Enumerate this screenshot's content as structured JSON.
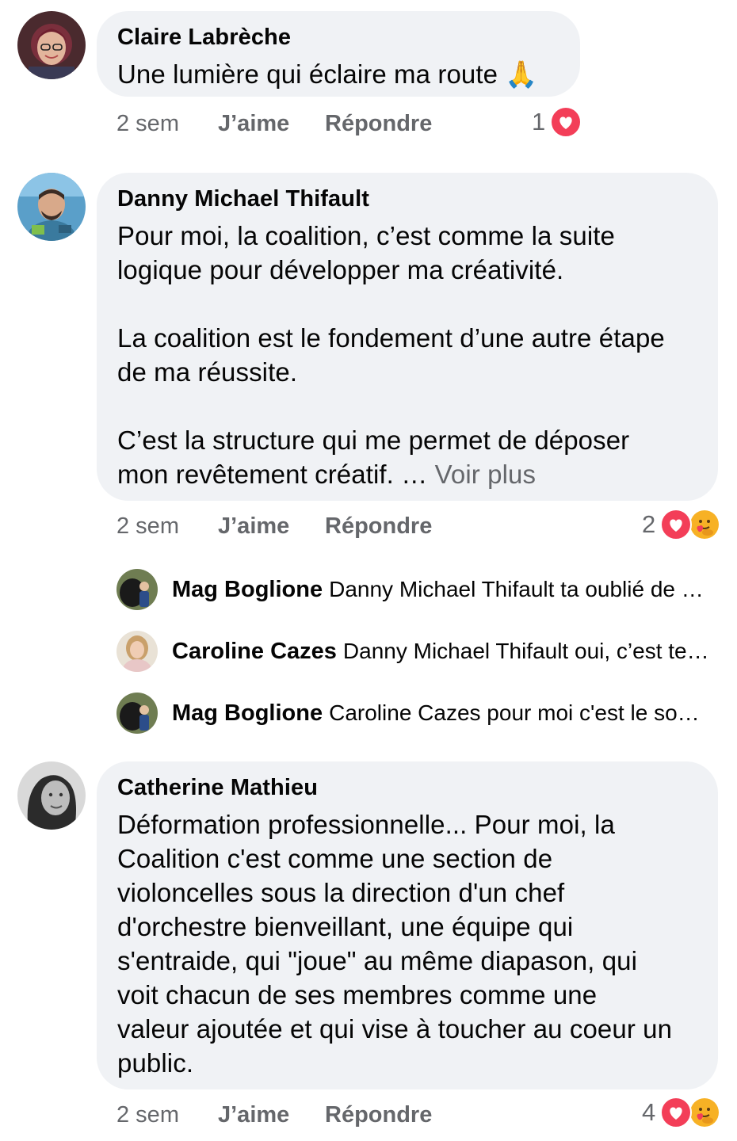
{
  "comments": [
    {
      "author": "Claire Labrèche",
      "text": "Une lumière qui éclaire ma route 🙏",
      "see_more": "",
      "time": "2 sem",
      "like_label": "J’aime",
      "reply_label": "Répondre",
      "reaction_count": "1",
      "reactions": [
        "love"
      ]
    },
    {
      "author": "Danny Michael Thifault",
      "text": "Pour moi, la coalition, c’est comme la suite\nlogique pour développer ma créativité.\n\nLa coalition est le fondement d’une autre étape\nde ma réussite.\n\nC’est la structure qui me permet de déposer\nmon revêtement  créatif. … ",
      "see_more": "Voir plus",
      "time": "2 sem",
      "like_label": "J’aime",
      "reply_label": "Répondre",
      "reaction_count": "2",
      "reactions": [
        "love",
        "care"
      ],
      "replies": [
        {
          "author": "Mag Boglione",
          "text": "Danny Michael Thifault ta oublié de …"
        },
        {
          "author": "Caroline Cazes",
          "text": "Danny Michael Thifault oui, c’est te…"
        },
        {
          "author": "Mag Boglione",
          "text": "Caroline Cazes pour moi c'est le so…"
        }
      ]
    },
    {
      "author": "Catherine Mathieu",
      "text": "Déformation professionnelle... Pour moi, la\nCoalition c'est comme une section de\nvioloncelles sous la direction d'un chef\nd'orchestre bienveillant, une équipe qui\ns'entraide, qui \"joue\" au même diapason, qui\nvoit chacun de ses membres comme une\nvaleur ajoutée et qui vise à toucher au coeur un\npublic.",
      "see_more": "",
      "time": "2 sem",
      "like_label": "J’aime",
      "reply_label": "Répondre",
      "reaction_count": "4",
      "reactions": [
        "love",
        "care"
      ]
    }
  ],
  "colors": {
    "bubble": "#f0f2f5",
    "secondary_text": "#65676b",
    "love": "#f33e58",
    "care": "#f7b125"
  }
}
